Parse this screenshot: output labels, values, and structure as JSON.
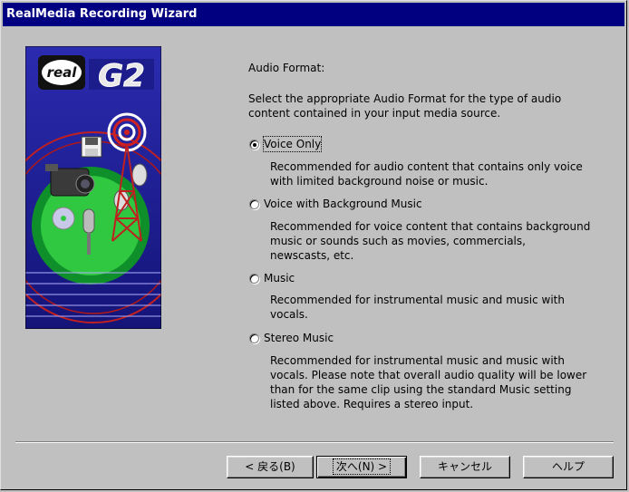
{
  "window": {
    "title": "RealMedia Recording Wizard"
  },
  "banner": {
    "logo_real": "real",
    "logo_g2": "G2"
  },
  "section": {
    "heading": "Audio Format:",
    "intro_line1": "Select the appropriate Audio Format for the type of audio",
    "intro_line2": "content contained in your input media source."
  },
  "options": [
    {
      "label": "Voice Only",
      "selected": true,
      "desc": [
        "Recommended for audio content that contains only voice",
        "with limited background noise or music."
      ]
    },
    {
      "label": "Voice with Background Music",
      "selected": false,
      "desc": [
        "Recommended for voice content that contains background",
        "music or sounds such as movies, commercials,",
        "newscasts, etc."
      ]
    },
    {
      "label": "Music",
      "selected": false,
      "desc": [
        "Recommended for instrumental music and music with",
        "vocals."
      ]
    },
    {
      "label": "Stereo Music",
      "selected": false,
      "desc": [
        "Recommended for instrumental music and music with",
        "vocals.  Please note that overall audio quality will be lower",
        "than for the same clip using the standard Music setting",
        "listed above.  Requires a stereo input."
      ]
    }
  ],
  "buttons": {
    "back": "< 戻る(B)",
    "next": "次へ(N) >",
    "cancel": "キャンセル",
    "help": "ヘルプ"
  },
  "colors": {
    "titlebar": "#000080",
    "face": "#c0c0c0",
    "banner_bg": "#1c1c8c"
  }
}
